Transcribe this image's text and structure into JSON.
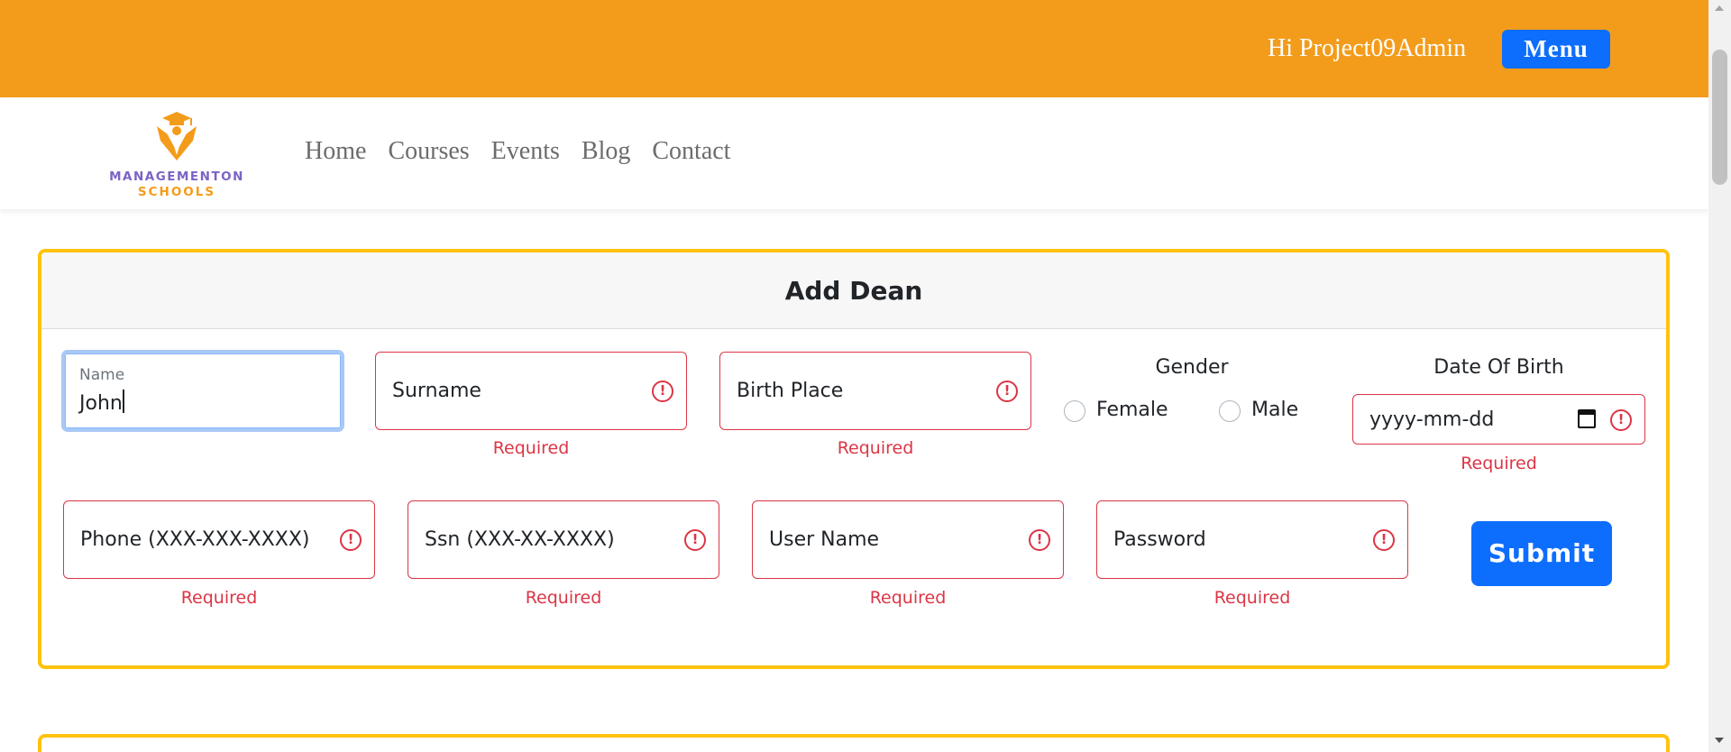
{
  "header": {
    "greeting": "Hi Project09Admin",
    "menu_label": "Menu"
  },
  "nav": {
    "logo_line1": "MANAGEMENTON",
    "logo_line2": "SCHOOLS",
    "links": [
      "Home",
      "Courses",
      "Events",
      "Blog",
      "Contact"
    ]
  },
  "form": {
    "title": "Add Dean",
    "name": {
      "label": "Name",
      "value": "John"
    },
    "surname": {
      "placeholder": "Surname",
      "error": "Required"
    },
    "birth_place": {
      "placeholder": "Birth Place",
      "error": "Required"
    },
    "gender": {
      "title": "Gender",
      "options": [
        "Female",
        "Male"
      ]
    },
    "date_of_birth": {
      "title": "Date Of Birth",
      "placeholder": "yyyy-mm-dd",
      "error": "Required"
    },
    "phone": {
      "placeholder": "Phone (XXX-XXX-XXXX)",
      "error": "Required"
    },
    "ssn": {
      "placeholder": "Ssn (XXX-XX-XXXX)",
      "error": "Required"
    },
    "username": {
      "placeholder": "User Name",
      "error": "Required"
    },
    "password": {
      "placeholder": "Password",
      "error": "Required"
    },
    "submit_label": "Submit",
    "error_icon_glyph": "!"
  },
  "colors": {
    "topbar": "#f39c1b",
    "primary": "#0d6efd",
    "card_border": "#ffc20e",
    "error": "#dc3545",
    "logo_purple": "#7b63c6"
  }
}
